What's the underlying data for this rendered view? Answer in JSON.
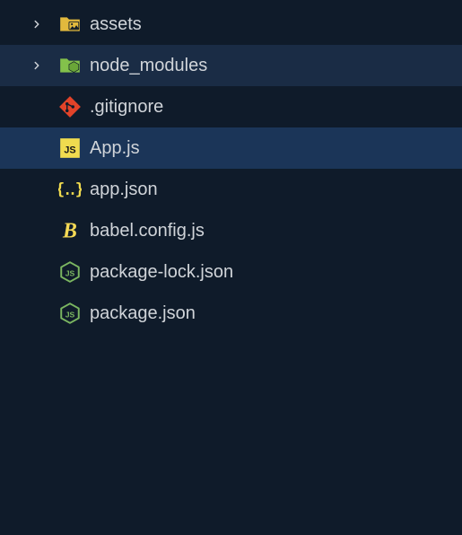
{
  "items": [
    {
      "name": "assets",
      "type": "folder",
      "state": "normal",
      "icon": "folder-images",
      "expandable": true
    },
    {
      "name": "node_modules",
      "type": "folder",
      "state": "hovered",
      "icon": "folder-node",
      "expandable": true
    },
    {
      "name": ".gitignore",
      "type": "file",
      "state": "normal",
      "icon": "git-icon",
      "expandable": false
    },
    {
      "name": "App.js",
      "type": "file",
      "state": "selected",
      "icon": "js-icon",
      "expandable": false
    },
    {
      "name": "app.json",
      "type": "file",
      "state": "normal",
      "icon": "json-icon",
      "expandable": false
    },
    {
      "name": "babel.config.js",
      "type": "file",
      "state": "normal",
      "icon": "babel-icon",
      "expandable": false
    },
    {
      "name": "package-lock.json",
      "type": "file",
      "state": "normal",
      "icon": "nodejs-icon",
      "expandable": false
    },
    {
      "name": "package.json",
      "type": "file",
      "state": "normal",
      "icon": "nodejs-icon",
      "expandable": false
    }
  ],
  "colors": {
    "bg": "#0f1b2a",
    "hover": "#1a2c45",
    "selected": "#1b3558",
    "text": "#d0d4d9"
  }
}
